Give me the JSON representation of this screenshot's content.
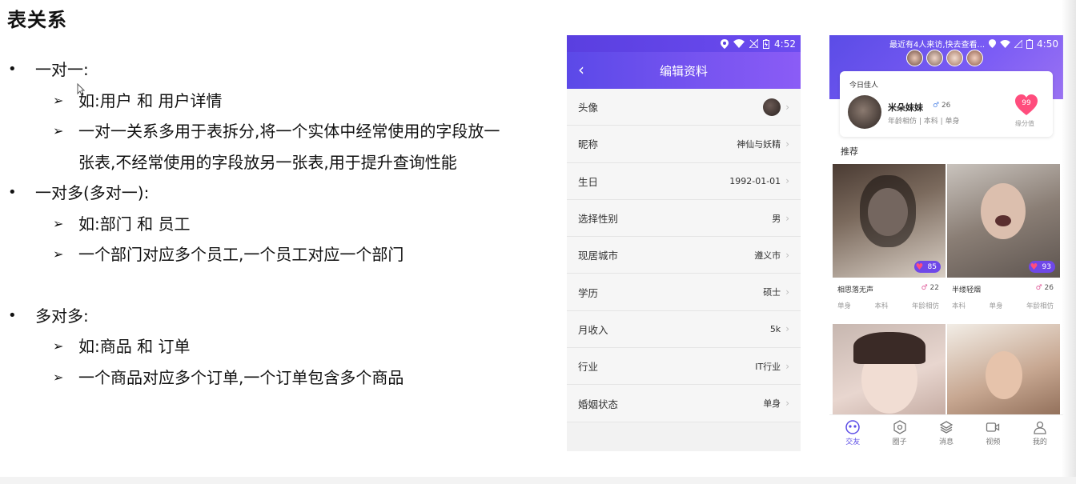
{
  "slide": {
    "title": "表关系",
    "one_to_one": {
      "heading": "一对一:",
      "example": "如:用户 和 用户详情",
      "desc_line1": "一对一关系多用于表拆分,将一个实体中经常使用的字段放一",
      "desc_line2": "张表,不经常使用的字段放另一张表,用于提升查询性能"
    },
    "one_to_many": {
      "heading": "一对多(多对一):",
      "example": "如:部门 和 员工",
      "desc": "一个部门对应多个员工,一个员工对应一个部门"
    },
    "many_to_many": {
      "heading": "多对多:",
      "example": "如:商品 和 订单",
      "desc": "一个商品对应多个订单,一个订单包含多个商品"
    }
  },
  "phone1": {
    "time": "4:52",
    "header_title": "编辑资料",
    "rows": [
      {
        "label": "头像",
        "value": ""
      },
      {
        "label": "昵称",
        "value": "神仙与妖精"
      },
      {
        "label": "生日",
        "value": "1992-01-01"
      },
      {
        "label": "选择性别",
        "value": "男"
      },
      {
        "label": "现居城市",
        "value": "遵义市"
      },
      {
        "label": "学历",
        "value": "硕士"
      },
      {
        "label": "月收入",
        "value": "5k"
      },
      {
        "label": "行业",
        "value": "IT行业"
      },
      {
        "label": "婚姻状态",
        "value": "单身"
      }
    ]
  },
  "phone2": {
    "time": "4:50",
    "visit_notice": "最近有4人来访,快去查看...",
    "today": {
      "label": "今日佳人",
      "name": "米朵妹妹",
      "age": "26",
      "tags": "年龄相仿 | 本科 | 单身",
      "score": "99",
      "score_label": "缘分值"
    },
    "recommend_title": "推荐",
    "cards": [
      {
        "name": "相思落无声",
        "age": "22",
        "score": "85",
        "tags": [
          "单身",
          "本科",
          "年龄相仿"
        ]
      },
      {
        "name": "半缕轻烟",
        "age": "26",
        "score": "93",
        "tags": [
          "本科",
          "单身",
          "年龄相仿"
        ]
      }
    ],
    "tabs": [
      "交友",
      "圈子",
      "消息",
      "视频",
      "我的"
    ]
  },
  "colors": {
    "accent": "#5b4ce6",
    "header_gradient_end": "#8b5cf6",
    "heart": "#ff4d7d"
  }
}
